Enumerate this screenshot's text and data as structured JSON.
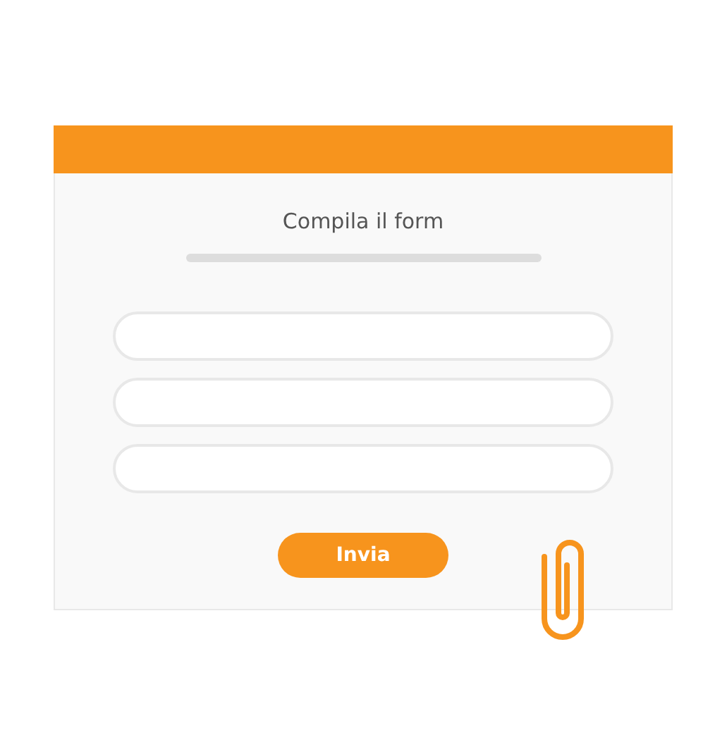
{
  "form": {
    "title": "Compila il form",
    "fields": [
      {
        "kind": "text"
      },
      {
        "kind": "text"
      },
      {
        "kind": "text"
      }
    ],
    "submit": "Invia"
  }
}
